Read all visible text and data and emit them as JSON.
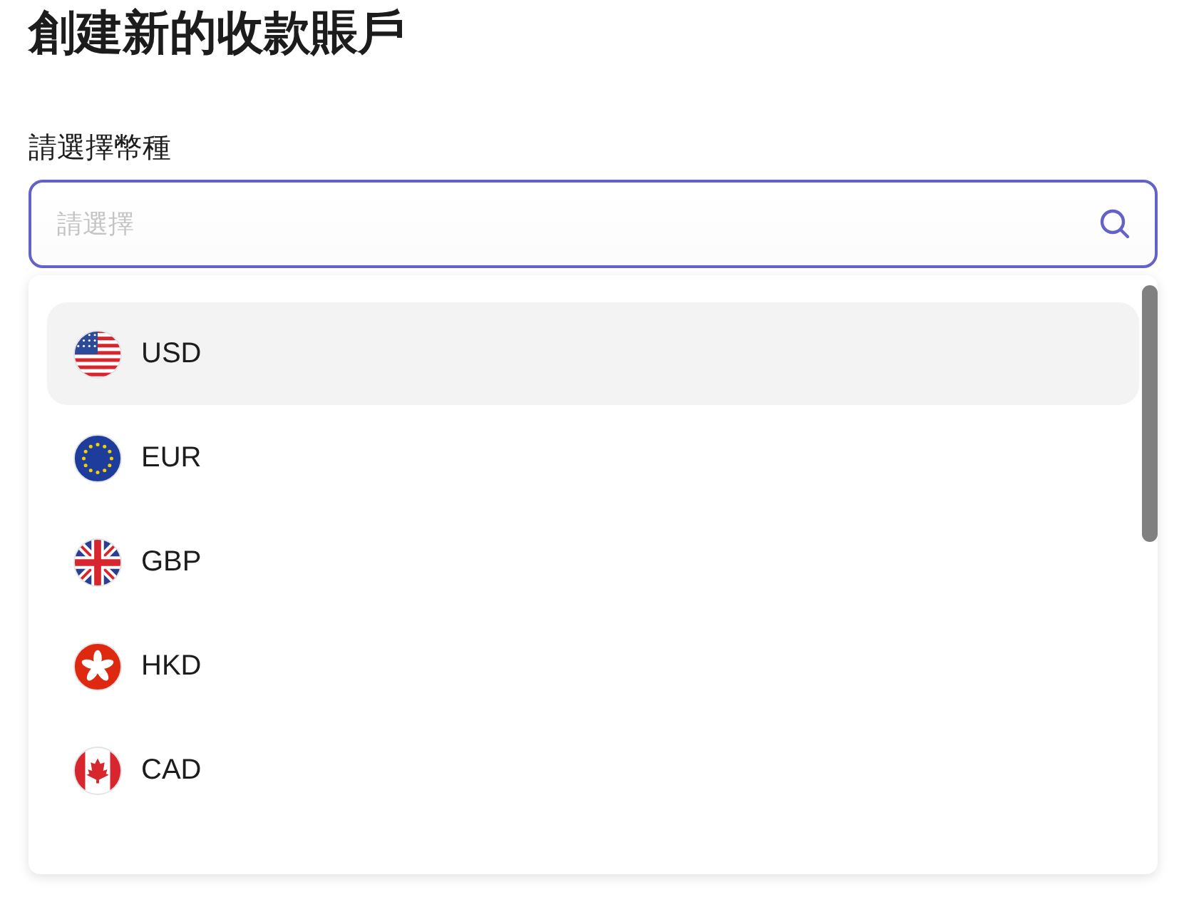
{
  "title": "創建新的收款賬戶",
  "field": {
    "label": "請選擇幣種",
    "placeholder": "請選擇"
  },
  "options": [
    {
      "label": "USD",
      "kind": "us",
      "selected": true
    },
    {
      "label": "EUR",
      "kind": "eu",
      "selected": false
    },
    {
      "label": "GBP",
      "kind": "gb",
      "selected": false
    },
    {
      "label": "HKD",
      "kind": "hk",
      "selected": false
    },
    {
      "label": "CAD",
      "kind": "ca",
      "selected": false
    }
  ]
}
